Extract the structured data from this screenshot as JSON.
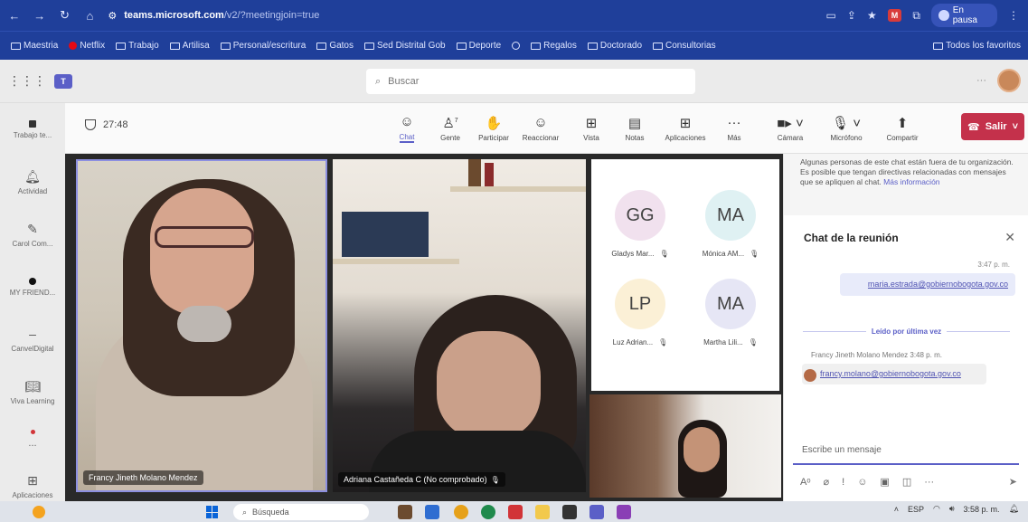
{
  "browser": {
    "url_domain": "teams.microsoft.com",
    "url_path": "/v2/?meetingjoin=true",
    "profile_label": "En pausa",
    "bookmarks": [
      "Maestria",
      "Netflix",
      "Trabajo",
      "Artilisa",
      "Personal/escritura",
      "Gatos",
      "Sed Distrital Gob",
      "Deporte",
      "Regalos",
      "Doctorado",
      "Consultorias"
    ],
    "bookmarks_right": "Todos los favoritos"
  },
  "teams_header": {
    "search_placeholder": "Buscar"
  },
  "left_rail": {
    "items": [
      {
        "label": "Trabajo te...",
        "icon": "square-icon"
      },
      {
        "label": "Actividad",
        "icon": "bell-icon"
      },
      {
        "label": "Carol Com...",
        "icon": "pencil-icon"
      },
      {
        "label": "MY FRIEND...",
        "icon": "dot-icon"
      },
      {
        "label": "CanvelDigital",
        "icon": "dash-icon"
      },
      {
        "label": "Viva Learning",
        "icon": "book-icon"
      },
      {
        "label": "...",
        "icon": "more-icon"
      },
      {
        "label": "Aplicaciones",
        "icon": "apps-icon"
      }
    ]
  },
  "meeting_bar": {
    "timer": "27:48",
    "tools": [
      {
        "label": "Chat",
        "icon": "chat-icon",
        "glyph": "☺"
      },
      {
        "label": "Gente",
        "icon": "people-icon",
        "glyph": "👥",
        "badge": "7"
      },
      {
        "label": "Participar",
        "icon": "raise-hand-icon",
        "glyph": "✋"
      },
      {
        "label": "Reaccionar",
        "icon": "reaction-icon",
        "glyph": "☺"
      },
      {
        "label": "Vista",
        "icon": "view-icon",
        "glyph": "⊞"
      },
      {
        "label": "Notas",
        "icon": "notes-icon",
        "glyph": "▤"
      },
      {
        "label": "Aplicaciones",
        "icon": "apps-icon",
        "glyph": "⊞"
      },
      {
        "label": "Más",
        "icon": "more-icon",
        "glyph": "···"
      }
    ],
    "devices": [
      {
        "label": "Cámara",
        "icon": "camera-icon"
      },
      {
        "label": "Micrófono",
        "icon": "mic-off-icon"
      },
      {
        "label": "Compartir",
        "icon": "share-icon"
      }
    ],
    "exit_label": "Salir"
  },
  "participants": {
    "video_tiles": [
      {
        "name": "Francy Jineth Molano Mendez"
      },
      {
        "name": "Adriana Castañeda C (No comprobado)"
      }
    ],
    "avatars": [
      {
        "initials": "GG",
        "name": "Gladys Mar...",
        "color": "#f1e1ee"
      },
      {
        "initials": "MA",
        "name": "Mónica AM...",
        "color": "#dff1f3"
      },
      {
        "initials": "LP",
        "name": "Luz Adrian...",
        "color": "#fbf0d6"
      },
      {
        "initials": "MA",
        "name": "Martha Lili...",
        "color": "#e6e6f5"
      }
    ]
  },
  "chat": {
    "external_notice": "Algunas personas de este chat están fuera de tu organización. Es posible que tengan directivas relacionadas con mensajes que se apliquen al chat.",
    "notice_link": "Más información",
    "title": "Chat de la reunión",
    "messages": [
      {
        "time": "3:47 p. m.",
        "text": "maria.estrada@gobiernobogota.gov.co"
      },
      {
        "author_meta": "Francy Jineth Molano Mendez  3:48 p. m.",
        "text": "francy.molano@gobiernobogota.gov.co"
      }
    ],
    "last_read_label": "Leído por última vez",
    "compose_placeholder": "Escribe un mensaje"
  },
  "taskbar": {
    "search_placeholder": "Búsqueda",
    "lang": "ESP",
    "clock": "3:58 p. m."
  }
}
